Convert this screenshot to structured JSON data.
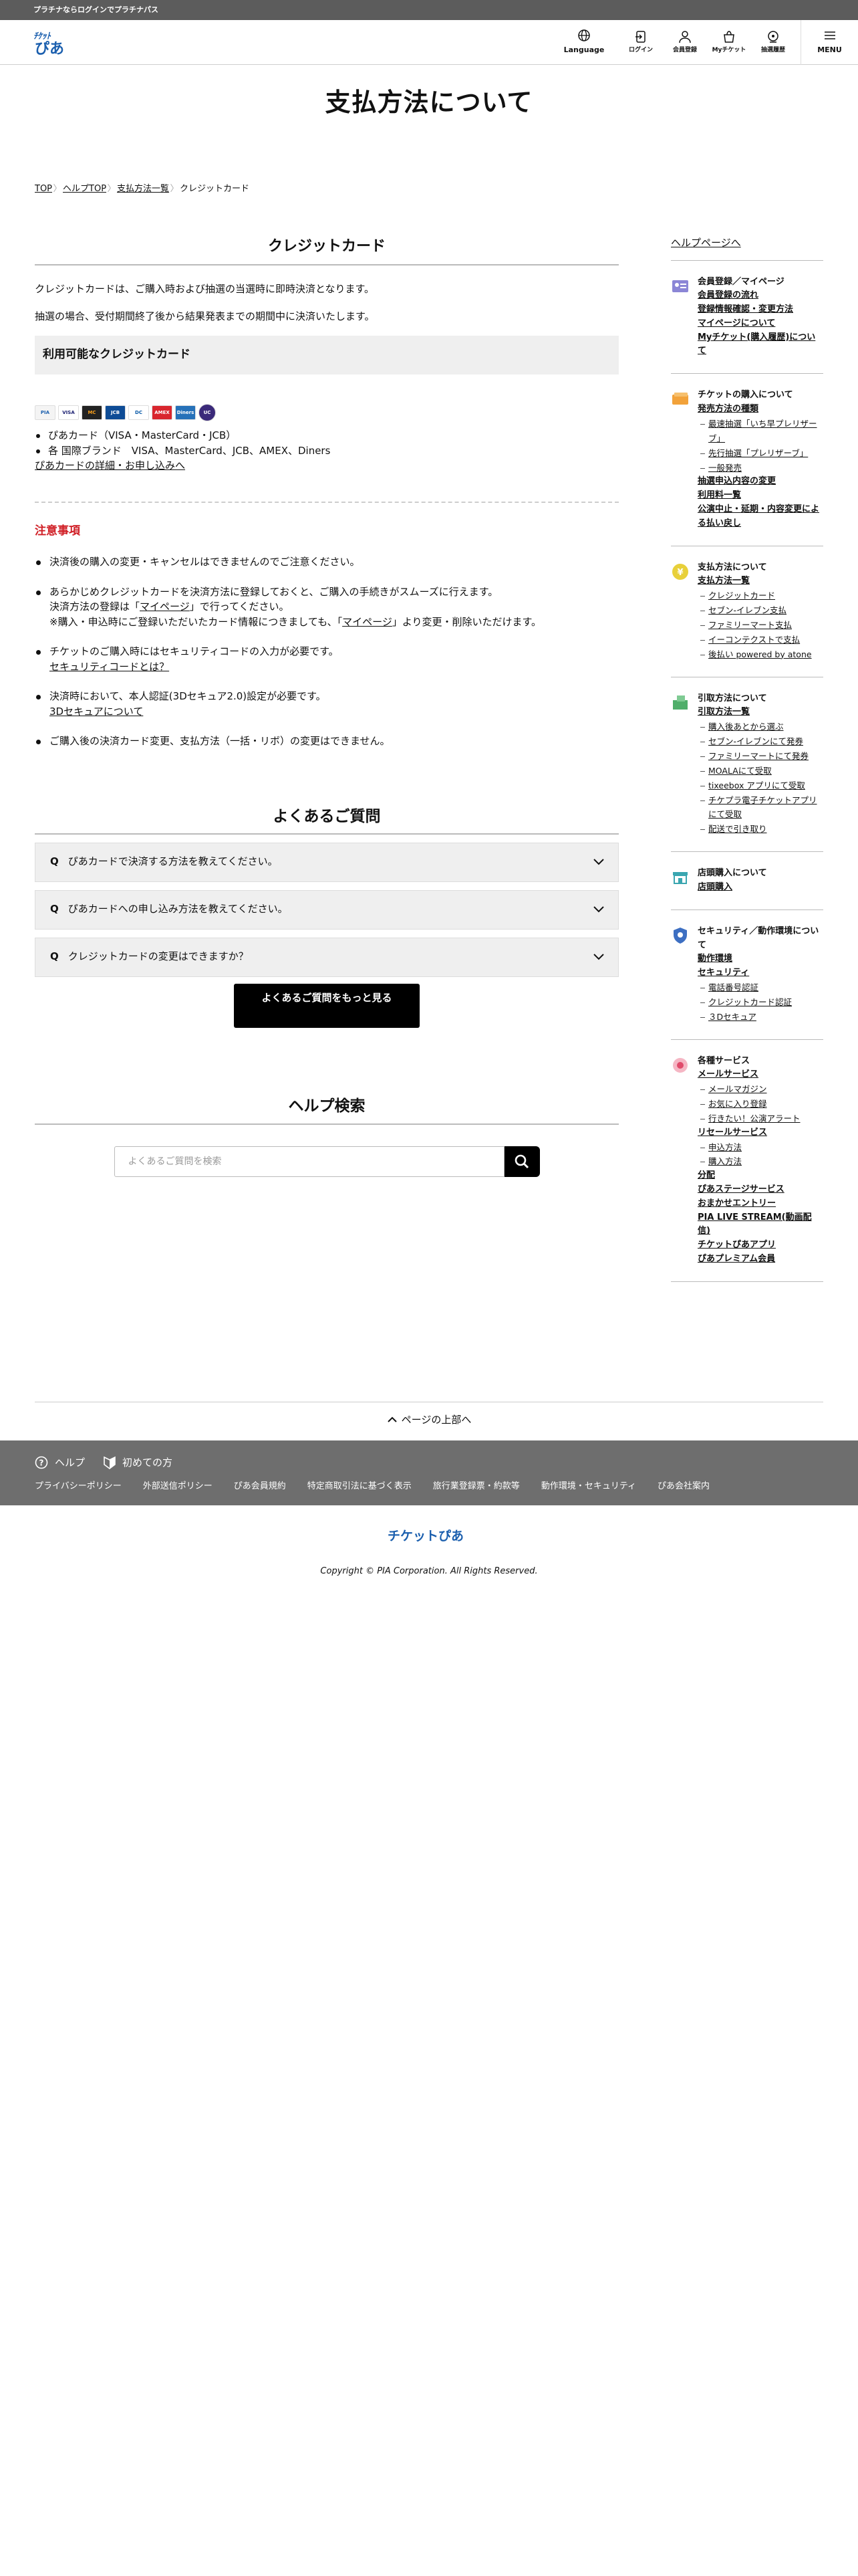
{
  "promo": "プラチナならログインでプラチナパス",
  "header": {
    "logo_text": "チケットぴあ",
    "nav": [
      {
        "label": "Language",
        "icon": "globe-icon"
      },
      {
        "label": "ログイン",
        "icon": "login-icon"
      },
      {
        "label": "会員登録",
        "icon": "user-icon"
      },
      {
        "label": "Myチケット",
        "icon": "ticket-bag-icon"
      },
      {
        "label": "抽選履歴",
        "icon": "lottery-icon"
      },
      {
        "label": "MENU",
        "icon": "hamburger-icon"
      }
    ]
  },
  "page_title": "支払方法について",
  "breadcrumb": [
    "TOP",
    "ヘルプTOP",
    "支払方法一覧",
    "クレジットカード"
  ],
  "main": {
    "section_title": "クレジットカード",
    "intro1": "クレジットカードは、ご購入時および抽選の当選時に即時決済となります。",
    "intro2": "抽選の場合、受付期間終了後から結果発表までの期間中に決済いたします。",
    "available_title": "利用可能なクレジットカード",
    "cards": [
      "PIA",
      "VISA",
      "MC",
      "JCB",
      "DC",
      "AMEX",
      "Diners",
      "UC"
    ],
    "card_list": [
      "ぴあカード（VISA・MasterCard・JCB）",
      "各 国際ブランド　VISA、MasterCard、JCB、AMEX、Diners"
    ],
    "card_link": "ぴあカードの詳細・お申し込みへ",
    "notice_title": "注意事項",
    "notes": {
      "n1": "決済後の購入の変更・キャンセルはできませんのでご注意ください。",
      "n2a_pre": "あらかじめクレジットカードを決済方法に登録しておくと、ご購入の手続きがスムーズに行えます。",
      "n2b_pre": "決済方法の登録は「",
      "n2b_link": "マイページ",
      "n2b_post": "」で行ってください。",
      "n2c_pre": "※購入・申込時にご登録いただいたカード情報につきましても、「",
      "n2c_link": "マイページ",
      "n2c_post": "」より変更・削除いただけます。",
      "n3": "チケットのご購入時にはセキュリティコードの入力が必要です。",
      "n3_link": "セキュリティコードとは？",
      "n4": "決済時において、本人認証(3Dセキュア2.0)設定が必要です。",
      "n4_link": "3Dセキュアについて",
      "n5": "ご購入後の決済カード変更、支払方法（一括・リボ）の変更はできません。"
    },
    "faq_title": "よくあるご質問",
    "faq_q": "Q",
    "faqs": [
      "ぴあカードで決済する方法を教えてください。",
      "ぴあカードへの申し込み方法を教えてください。",
      "クレジットカードの変更はできますか？"
    ],
    "faq_more": "よくあるご質問をもっと見る",
    "search_title": "ヘルプ検索",
    "search_placeholder": "よくあるご質問を検索"
  },
  "sidebar": {
    "help_link": "ヘルプページへ",
    "groups": [
      {
        "title": "会員登録／マイページ",
        "links": [
          "会員登録の流れ",
          "登録情報確認・変更方法",
          "マイページについて",
          "Myチケット(購入履歴)について"
        ],
        "subs": []
      },
      {
        "title": "チケットの購入について",
        "links": [
          "発売方法の種類"
        ],
        "subs": [
          "最速抽選「いち早プレリザーブ」",
          "先行抽選「プレリザーブ」",
          "一般発売"
        ],
        "links2": [
          "抽選申込内容の変更",
          "利用料一覧",
          "公演中止・延期・内容変更による払い戻し"
        ]
      },
      {
        "title": "支払方法について",
        "links": [
          "支払方法一覧"
        ],
        "subs": [
          "クレジットカード",
          "セブン-イレブン支払",
          "ファミリーマート支払",
          "イーコンテクストで支払",
          "後払い powered by atone"
        ]
      },
      {
        "title": "引取方法について",
        "links": [
          "引取方法一覧"
        ],
        "subs": [
          "購入後あとから選ぶ",
          "セブン-イレブンにて発券",
          "ファミリーマートにて発券",
          "MOALAにて受取",
          "tixeebox アプリにて受取",
          "チケプラ電子チケットアプリにて受取",
          "配送で引き取り"
        ]
      },
      {
        "title": "店頭購入について",
        "links": [
          "店頭購入"
        ],
        "subs": []
      },
      {
        "title": "セキュリティ／動作環境について",
        "links": [
          "動作環境",
          "セキュリティ"
        ],
        "subs": [
          "電話番号認証",
          "クレジットカード認証",
          "３Dセキュア"
        ]
      },
      {
        "title": "各種サービス",
        "links": [
          "メールサービス"
        ],
        "subs": [
          "メールマガジン",
          "お気に入り登録",
          "行きたい！公演アラート"
        ],
        "links2": [
          "リセールサービス"
        ],
        "subs2": [
          "申込方法",
          "購入方法"
        ],
        "links3": [
          "分配",
          "ぴあステージサービス",
          "おまかせエントリー",
          "PIA LIVE STREAM(動画配信)",
          "チケットぴあアプリ",
          "ぴあプレミアム会員"
        ]
      }
    ]
  },
  "back_to_top": "ページの上部へ",
  "footer": {
    "help": "ヘルプ",
    "first": "初めての方",
    "links": [
      "プライバシーポリシー",
      "外部送信ポリシー",
      "ぴあ会員規約",
      "特定商取引法に基づく表示",
      "旅行業登録票・約款等",
      "動作環境・セキュリティ",
      "ぴあ会社案内"
    ],
    "logo_text": "チケットぴあ",
    "copyright": "Copyright © PIA Corporation. All Rights Reserved."
  }
}
